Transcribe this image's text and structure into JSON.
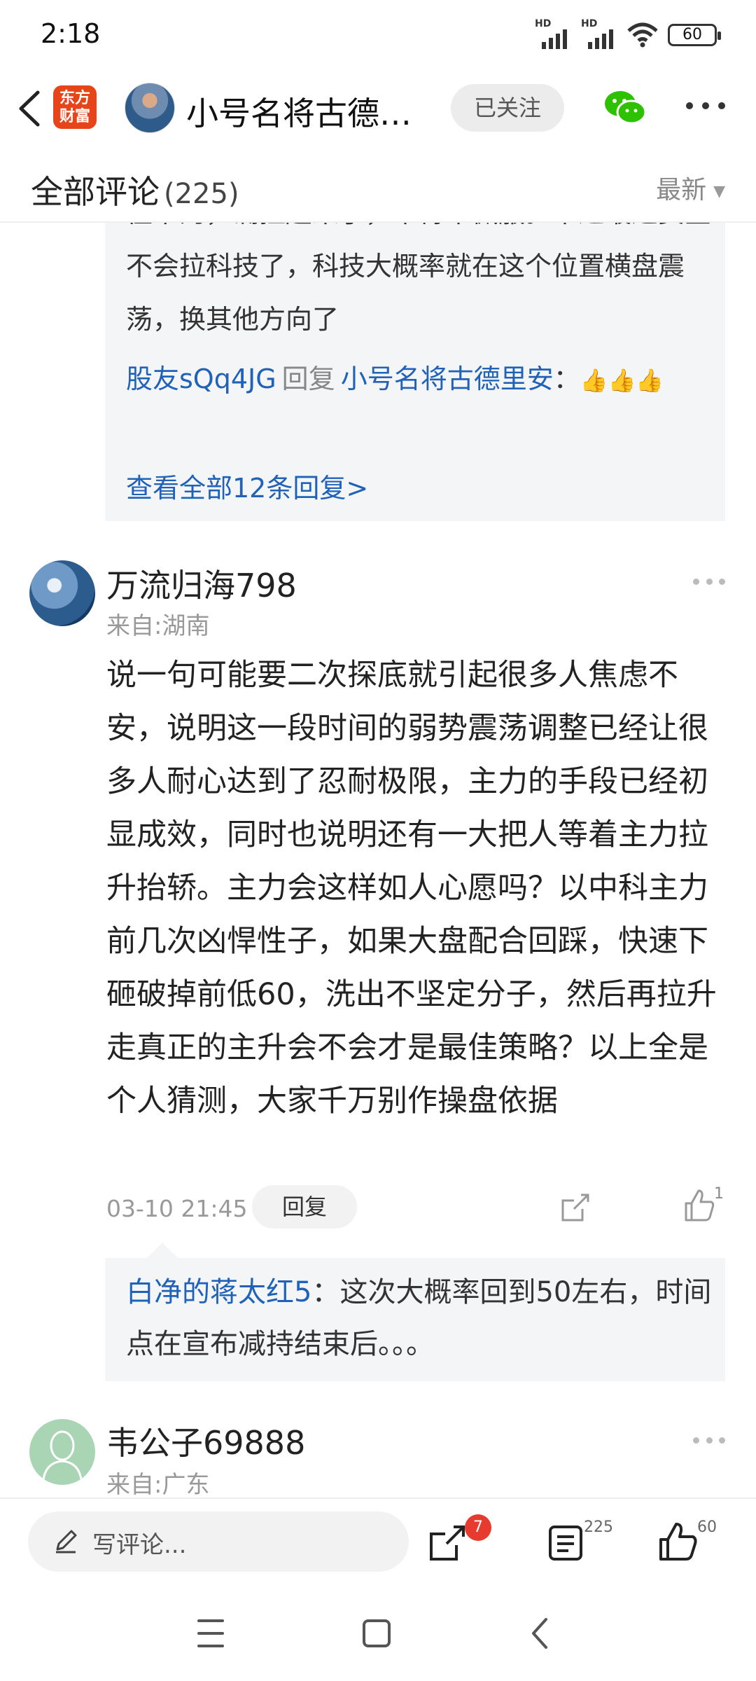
{
  "status_bar": {
    "time": "2:18",
    "signal1_label": "HD",
    "signal2_label": "HD",
    "battery": "60"
  },
  "header": {
    "logo_line1": "东方",
    "logo_line2": "财富",
    "author_name": "小号名将古德…",
    "follow_label": "已关注"
  },
  "section": {
    "title": "全部评论",
    "count": "(225)",
    "sort_label": "最新"
  },
  "reply_box_1": {
    "clipped_text": "往下的，确拉起来了，不得不佩服。不过最近资金不会拉科技了，科技大概率就在这个位置横盘震荡，换其他方向了",
    "reply_from": "股友sQq4JG",
    "reply_word": "回复",
    "reply_to": "小号名将古德里安",
    "colon": "：",
    "thumbs": "👍👍👍",
    "view_all": "查看全部12条回复>"
  },
  "comment_2": {
    "user": "万流归海798",
    "location": "来自:湖南",
    "body": "说一句可能要二次探底就引起很多人焦虑不安，说明这一段时间的弱势震荡调整已经让很多人耐心达到了忍耐极限，主力的手段已经初显成效，同时也说明还有一大把人等着主力拉升抬轿。主力会这样如人心愿吗？以中科主力前几次凶悍性子，如果大盘配合回踩，快速下砸破掉前低60，洗出不坚定分子，然后再拉升走真正的主升会不会才是最佳策略？以上全是个人猜测，大家千万别作操盘依据",
    "date": "03-10 21:45",
    "reply_label": "回复",
    "like_count": "1",
    "sub_reply_user": "白净的蒋太红5",
    "sub_reply_text": "：这次大概率回到50左右，时间点在宣布减持结束后。。。"
  },
  "comment_3": {
    "user": "韦公子69888",
    "location": "来自:广东"
  },
  "bottom_bar": {
    "placeholder": "写评论...",
    "share_badge": "7",
    "comments_count": "225",
    "likes_count": "60"
  },
  "colors": {
    "link_blue": "#1f62b8",
    "brand_orange": "#e8441a",
    "badge_red": "#e63b2e",
    "wechat_green": "#2dc100"
  }
}
